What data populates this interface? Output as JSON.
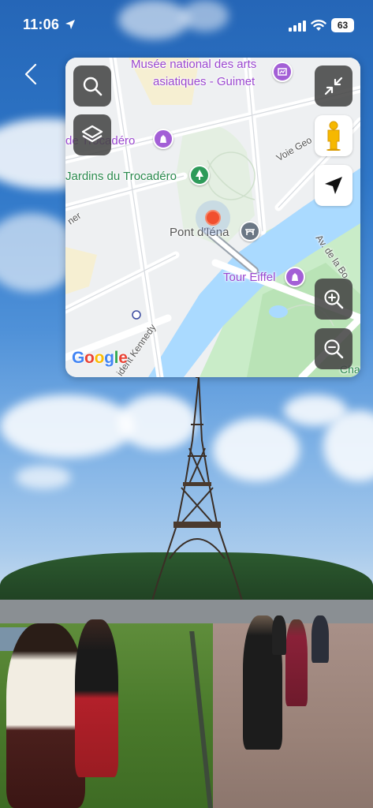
{
  "status_bar": {
    "time": "11:06",
    "battery": "63"
  },
  "map": {
    "labels": {
      "museum_line1": "Musée national des arts",
      "museum_line2": "asiatiques - Guimet",
      "trocadero": "de Trocadéro",
      "jardins": "Jardins du Trocadéro",
      "pont_iena": "Pont d'Iéna",
      "tour_eiffel": "Tour Eiffel",
      "voie": "Voie Geo",
      "av_bo": "Av. de la Bo",
      "kennedy": "ident Kennedy",
      "ner": "ner",
      "champ": "Champ"
    },
    "google_logo": {
      "G": "G",
      "o1": "o",
      "o2": "o",
      "g": "g",
      "l": "l",
      "e": "e"
    },
    "colors": {
      "water": "#aadaff",
      "park": "#c9ecc8",
      "poi_purple": "#a35fd6",
      "poi_green": "#2e9b5a",
      "poi_gray": "#6b7785",
      "pin": "#f1502f"
    }
  },
  "icons": {
    "back": "chevron-left-icon",
    "search": "search-icon",
    "layers": "layers-icon",
    "collapse": "collapse-icon",
    "pegman": "pegman-icon",
    "navigation": "navigation-arrow-icon",
    "zoom_in": "zoom-in-icon",
    "zoom_out": "zoom-out-icon"
  }
}
